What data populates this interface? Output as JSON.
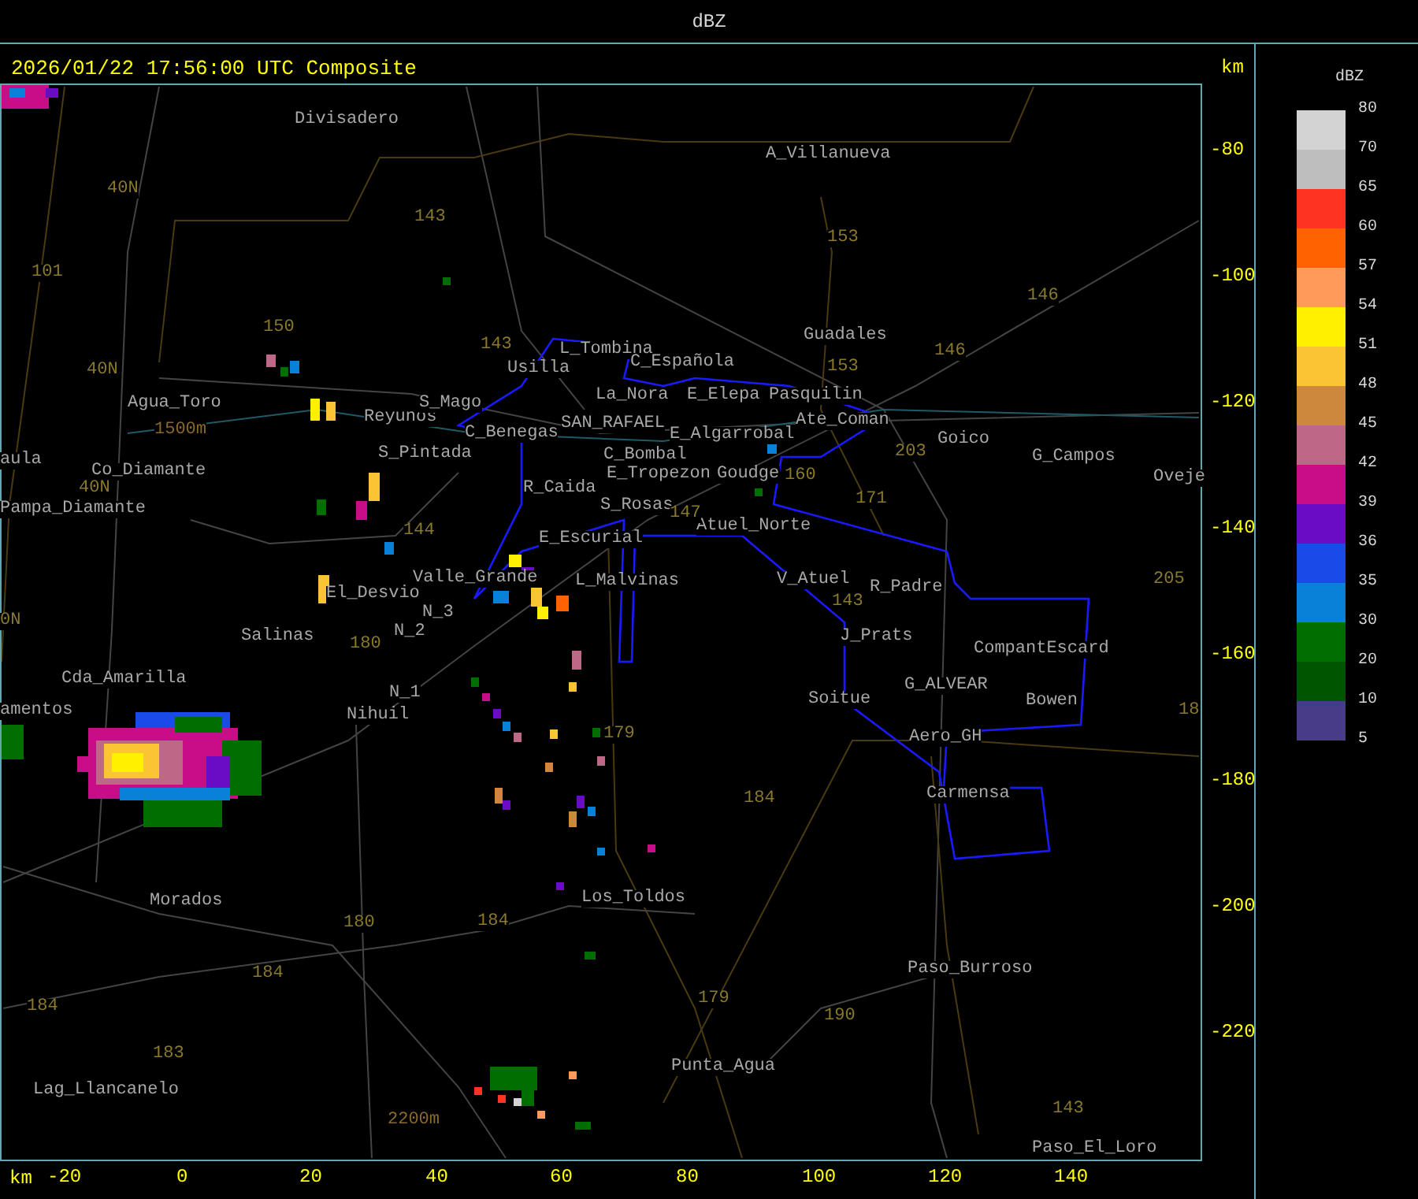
{
  "window": {
    "title": "dBZ"
  },
  "header": {
    "timestamp": "2026/01/22 17:56:00 UTC Composite"
  },
  "map": {
    "places": [
      "Divisadero",
      "A_Villanueva",
      "Guadales",
      "L_Tombina",
      "Usilla",
      "C_Española",
      "Agua_Toro",
      "Reyunos",
      "S_Mago",
      "La_Nora",
      "E_Elepa",
      "Pasquilin",
      "Ate_Coman",
      "C_Benegas",
      "SAN_RAFAEL",
      "E_Algarrobal",
      "Goico",
      "aula",
      "S_Pintada",
      "C_Bombal",
      "G_Campos",
      "Co_Diamante",
      "E_Tropezon",
      "Goudge",
      "Oveje",
      "R_Caida",
      "Pampa_Diamante",
      "S_Rosas",
      "E_Escurial",
      "Atuel_Norte",
      "Valle_Grande",
      "L_Malvinas",
      "V_Atuel",
      "R_Padre",
      "El_Desvio",
      "N_3",
      "Salinas",
      "N_2",
      "J_Prats",
      "CompantEscard",
      "Cda_Amarilla",
      "N_1",
      "G_ALVEAR",
      "Soitue",
      "Bowen",
      "amentos",
      "Nihuil",
      "Aero_GH",
      "Carmensa",
      "Los_Toldos",
      "Morados",
      "Paso_Burroso",
      "Punta_Agua",
      "Lag_Llancanelo",
      "Paso_El_Loro"
    ],
    "routes": [
      "143",
      "153",
      "146",
      "40N",
      "101",
      "150",
      "143",
      "40N",
      "153",
      "146",
      "203",
      "160",
      "171",
      "40N",
      "144",
      "147",
      "205",
      "143",
      "180",
      "0N",
      "179",
      "18",
      "184",
      "180",
      "184",
      "184",
      "184",
      "179",
      "190",
      "183",
      "143"
    ],
    "elevations": [
      "1500m",
      "2200m"
    ],
    "y_axis": {
      "unit": "km",
      "ticks": [
        "-80",
        "-100",
        "-120",
        "-140",
        "-160",
        "-180",
        "-200",
        "-220"
      ]
    },
    "x_axis": {
      "unit": "km",
      "ticks": [
        "-20",
        "0",
        "20",
        "40",
        "60",
        "80",
        "100",
        "120",
        "140"
      ]
    }
  },
  "legend": {
    "title": "dBZ",
    "items": [
      {
        "label": "80",
        "color": "#d3d3d3"
      },
      {
        "label": "70",
        "color": "#bebebe"
      },
      {
        "label": "65",
        "color": "#ff3322"
      },
      {
        "label": "60",
        "color": "#ff6200"
      },
      {
        "label": "57",
        "color": "#ff9a5a"
      },
      {
        "label": "54",
        "color": "#fff000"
      },
      {
        "label": "51",
        "color": "#fac435"
      },
      {
        "label": "48",
        "color": "#cd883b"
      },
      {
        "label": "45",
        "color": "#bc6886"
      },
      {
        "label": "42",
        "color": "#c90d89"
      },
      {
        "label": "39",
        "color": "#6a0bc5"
      },
      {
        "label": "36",
        "color": "#1a4ae8"
      },
      {
        "label": "35",
        "color": "#0882d8"
      },
      {
        "label": "30",
        "color": "#006e00"
      },
      {
        "label": "20",
        "color": "#005500"
      },
      {
        "label": "10",
        "color": "#483c88"
      }
    ],
    "min_label": "5"
  }
}
